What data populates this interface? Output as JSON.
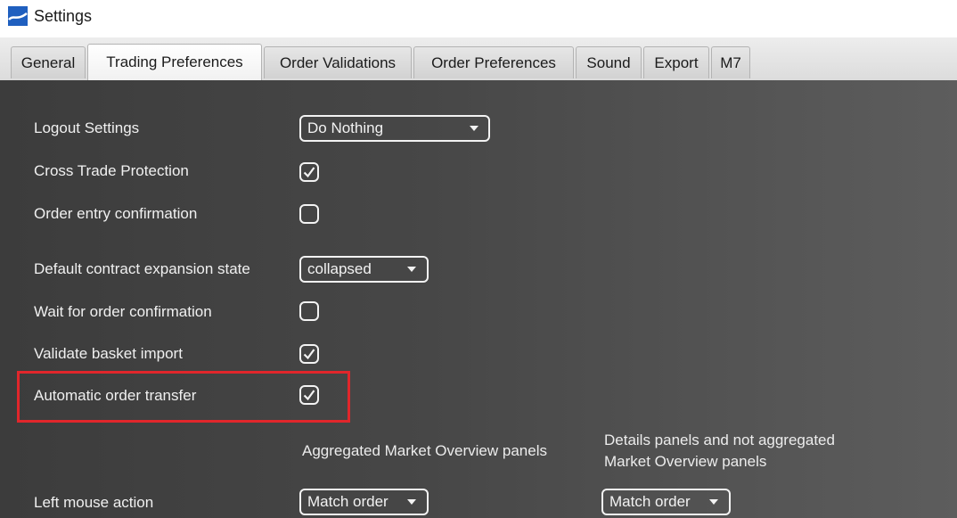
{
  "window": {
    "title": "Settings"
  },
  "tabs": [
    {
      "label": "General"
    },
    {
      "label": "Trading Preferences",
      "active": true
    },
    {
      "label": "Order Validations"
    },
    {
      "label": "Order Preferences"
    },
    {
      "label": "Sound"
    },
    {
      "label": "Export"
    },
    {
      "label": "M7"
    }
  ],
  "settings": {
    "logout": {
      "label": "Logout Settings",
      "value": "Do Nothing"
    },
    "cross_trade": {
      "label": "Cross Trade Protection",
      "checked": true
    },
    "order_entry_confirmation": {
      "label": "Order entry confirmation",
      "checked": false
    },
    "default_expansion": {
      "label": "Default contract expansion state",
      "value": "collapsed"
    },
    "wait_confirmation": {
      "label": "Wait for order confirmation",
      "checked": false
    },
    "validate_basket": {
      "label": "Validate basket import",
      "checked": true
    },
    "auto_transfer": {
      "label": "Automatic order transfer",
      "checked": true
    }
  },
  "mouse_section": {
    "col_aggregated": "Aggregated Market Overview panels",
    "col_details_line1": "Details panels and not aggregated",
    "col_details_line2": "Market Overview panels",
    "left_mouse": {
      "label": "Left mouse action",
      "aggregated_value": "Match order",
      "details_value": "Match order"
    }
  },
  "colors": {
    "highlight": "#e1262b",
    "panel_bg": "#444444",
    "text": "#f0f0f0"
  }
}
